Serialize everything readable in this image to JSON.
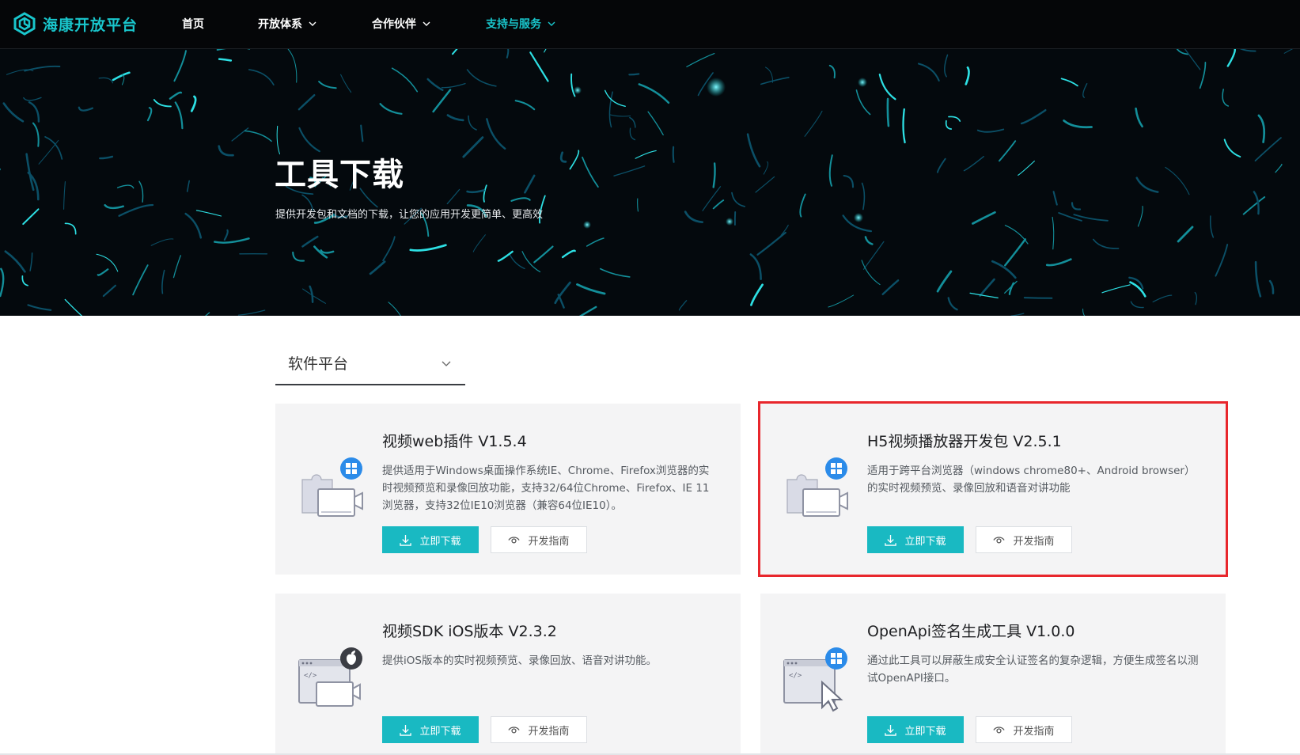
{
  "nav": {
    "logo_text": "海康开放平台",
    "items": [
      {
        "label": "首页",
        "has_dropdown": false,
        "active": false
      },
      {
        "label": "开放体系",
        "has_dropdown": true,
        "active": false
      },
      {
        "label": "合作伙伴",
        "has_dropdown": true,
        "active": false
      },
      {
        "label": "支持与服务",
        "has_dropdown": true,
        "active": true
      }
    ]
  },
  "hero": {
    "title": "工具下载",
    "subtitle": "提供开发包和文档的下载，让您的应用开发更简单、更高效"
  },
  "platform_select": {
    "selected": "软件平台"
  },
  "cards": [
    {
      "title": "视频web插件 V1.5.4",
      "desc": "提供适用于Windows桌面操作系统IE、Chrome、Firefox浏览器的实时视频预览和录像回放功能，支持32/64位Chrome、Firefox、IE 11浏览器，支持32位IE10浏览器（兼容64位IE10）。",
      "download_label": "立即下载",
      "guide_label": "开发指南",
      "icon": "puzzle-windows-icon",
      "highlighted": false
    },
    {
      "title": "H5视频播放器开发包 V2.5.1",
      "desc": "适用于跨平台浏览器（windows chrome80+、Android browser）的实时视频预览、录像回放和语音对讲功能",
      "download_label": "立即下载",
      "guide_label": "开发指南",
      "icon": "puzzle-windows-icon",
      "highlighted": true
    },
    {
      "title": "视频SDK iOS版本 V2.3.2",
      "desc": "提供iOS版本的实时视频预览、录像回放、语音对讲功能。",
      "download_label": "立即下载",
      "guide_label": "开发指南",
      "icon": "code-window-apple-icon",
      "highlighted": false
    },
    {
      "title": "OpenApi签名生成工具 V1.0.0",
      "desc": "通过此工具可以屏蔽生成安全认证签名的复杂逻辑，方便生成签名以测试OpenAPI接口。",
      "download_label": "立即下载",
      "guide_label": "开发指南",
      "icon": "code-window-cursor-icon",
      "highlighted": false
    }
  ],
  "colors": {
    "accent": "#19b9c2",
    "nav_bg": "#050608",
    "highlight_border": "#e8262c",
    "card_bg": "#f4f4f5"
  }
}
